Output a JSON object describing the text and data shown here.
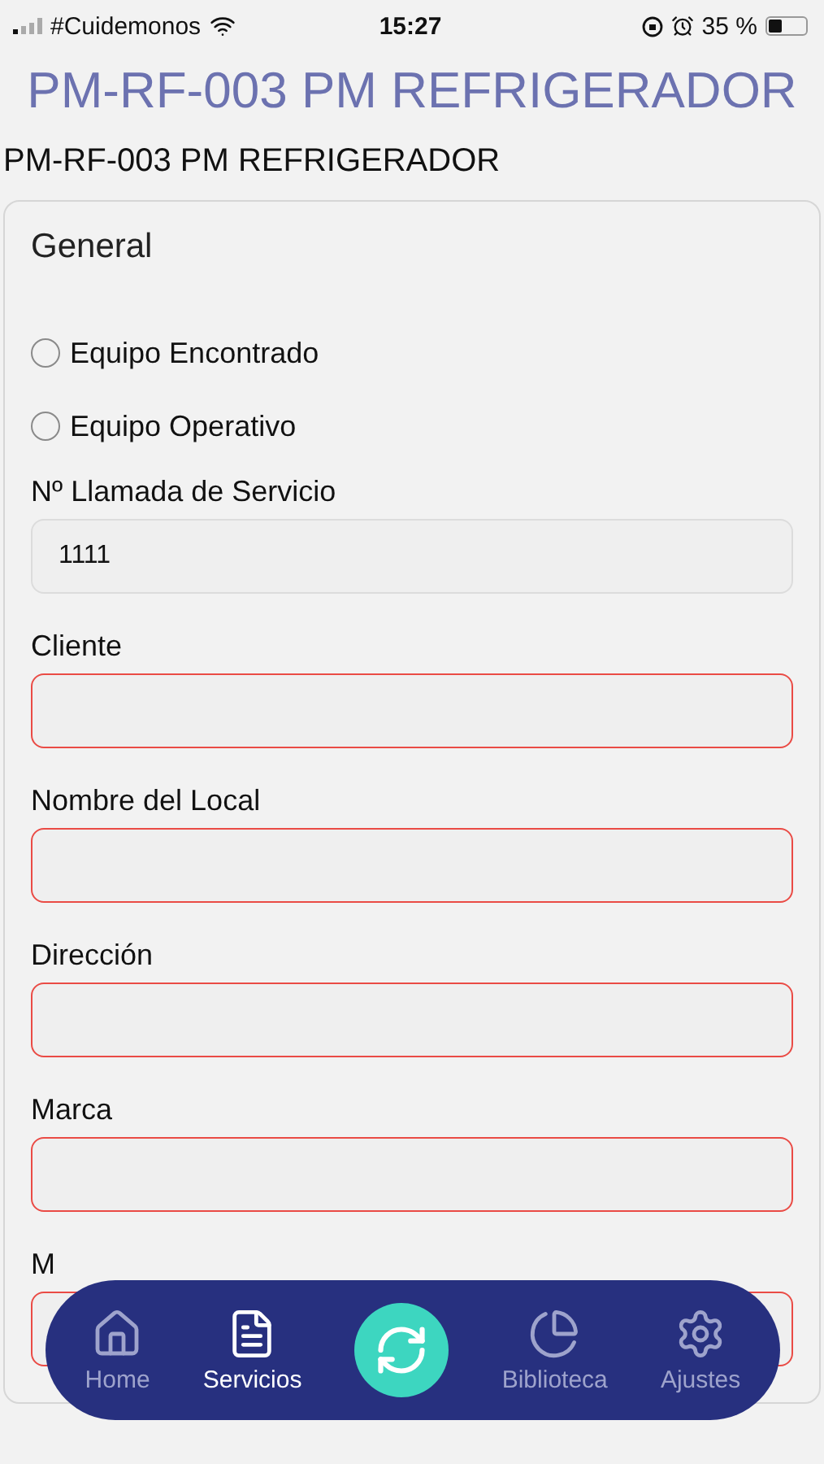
{
  "status_bar": {
    "carrier": "#Cuidemonos",
    "time": "15:27",
    "battery": "35 %"
  },
  "header": {
    "title": "PM-RF-003 PM REFRIGERADOR"
  },
  "form": {
    "title": "PM-RF-003 PM REFRIGERADOR",
    "section": "General",
    "options": [
      {
        "label": "Equipo Encontrado",
        "selected": false
      },
      {
        "label": "Equipo Operativo",
        "selected": false
      }
    ],
    "fields": [
      {
        "label": "Nº Llamada de Servicio",
        "value": "1111",
        "invalid": false
      },
      {
        "label": "Cliente",
        "invalid": true
      },
      {
        "label": "Nombre del Local",
        "invalid": true
      },
      {
        "label": "Dirección",
        "invalid": true
      },
      {
        "label": "Marca",
        "invalid": true
      },
      {
        "label": "M",
        "invalid": true
      }
    ]
  },
  "nav": {
    "items": [
      {
        "kind": "home",
        "label": "Home",
        "selected": false
      },
      {
        "kind": "services",
        "label": "Servicios",
        "selected": true
      },
      {
        "kind": "sync",
        "selected": false
      },
      {
        "kind": "library",
        "label": "Biblioteca",
        "selected": false
      },
      {
        "kind": "settings",
        "label": "Ajustes",
        "selected": false
      }
    ]
  }
}
